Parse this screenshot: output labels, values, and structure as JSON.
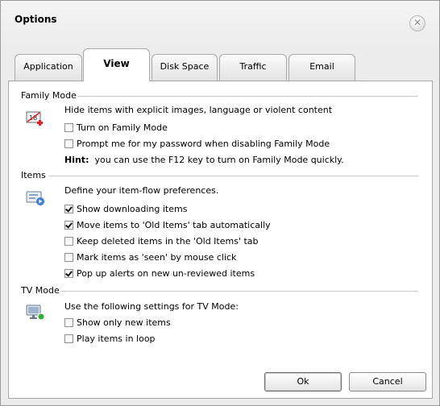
{
  "window": {
    "title": "Options"
  },
  "tabs": [
    {
      "label": "Application"
    },
    {
      "label": "View",
      "active": true
    },
    {
      "label": "Disk Space"
    },
    {
      "label": "Traffic"
    },
    {
      "label": "Email"
    }
  ],
  "family_mode": {
    "title": "Family Mode",
    "description": "Hide items with explicit images, language or violent content",
    "icon_name": "family-mode-18-icon",
    "options": [
      {
        "label": "Turn on Family Mode",
        "checked": false
      },
      {
        "label": "Prompt me for my password when disabling Family Mode",
        "checked": false
      }
    ],
    "hint_label": "Hint:",
    "hint_text": "you can use the F12 key to turn on Family Mode quickly."
  },
  "items": {
    "title": "Items",
    "description": "Define your item-flow preferences.",
    "icon_name": "item-flow-icon",
    "options": [
      {
        "label": "Show downloading items",
        "checked": true
      },
      {
        "label": "Move items to 'Old Items' tab automatically",
        "checked": true
      },
      {
        "label": "Keep deleted items in the 'Old Items' tab",
        "checked": false
      },
      {
        "label": "Mark items as 'seen' by mouse click",
        "checked": false
      },
      {
        "label": "Pop up alerts on new un-reviewed items",
        "checked": true
      }
    ]
  },
  "tv_mode": {
    "title": "TV Mode",
    "description": "Use the following settings for TV Mode:",
    "icon_name": "tv-monitor-icon",
    "options": [
      {
        "label": "Show only new items",
        "checked": false
      },
      {
        "label": "Play items in loop",
        "checked": false
      }
    ]
  },
  "buttons": {
    "ok": "Ok",
    "cancel": "Cancel"
  },
  "colors": {
    "accent_red": "#d8262e",
    "accent_blue": "#3d7fd4",
    "accent_green": "#2fae3a"
  }
}
